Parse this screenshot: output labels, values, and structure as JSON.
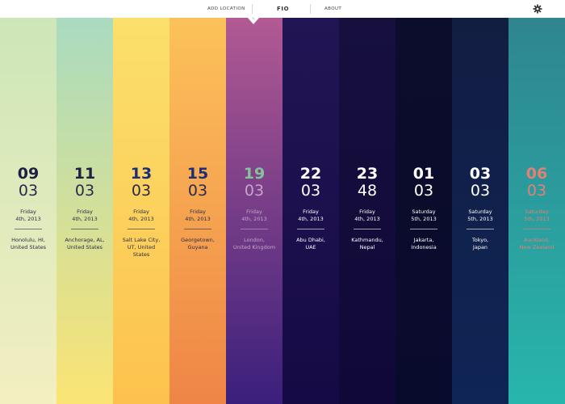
{
  "nav": {
    "add_location": "ADD LOCATION",
    "brand": "FIO",
    "about": "ABOUT",
    "settings_icon": "gear-icon"
  },
  "columns": [
    {
      "hour": "09",
      "minute": "03",
      "day": "Friday",
      "date": "4th, 2013",
      "place_line1": "Honolulu, HI,",
      "place_line2": "United States",
      "place_line3": "",
      "top": "#cde6b8",
      "bottom": "#f3efc1",
      "hour_color": "#1e1f44",
      "text_color": "#2a2b4a"
    },
    {
      "hour": "11",
      "minute": "03",
      "day": "Friday",
      "date": "4th, 2013",
      "place_line1": "Anchorage, AL,",
      "place_line2": "United States",
      "place_line3": "",
      "top": "#a9dbc0",
      "bottom": "#fbe474",
      "hour_color": "#1e1f44",
      "text_color": "#2a2b4a"
    },
    {
      "hour": "13",
      "minute": "03",
      "day": "Friday",
      "date": "4th, 2013",
      "place_line1": "Salt Lake City,",
      "place_line2": "UT, United",
      "place_line3": "States",
      "top": "#fbe06c",
      "bottom": "#fdc24d",
      "hour_color": "#1d2d7a",
      "text_color": "#2a2b4a"
    },
    {
      "hour": "15",
      "minute": "03",
      "day": "Friday",
      "date": "4th, 2013",
      "place_line1": "Georgetown,",
      "place_line2": "Guyana",
      "place_line3": "",
      "top": "#fcc25a",
      "bottom": "#ef8546",
      "hour_color": "#1d2d7a",
      "text_color": "#2a2b4a"
    },
    {
      "hour": "19",
      "minute": "03",
      "day": "Friday",
      "date": "4th, 2013",
      "place_line1": "London,",
      "place_line2": "United Kingdom",
      "place_line3": "",
      "top": "#b25a93",
      "bottom": "#3a1f7c",
      "hour_color": "#86c39a",
      "text_color": "#c4a6c9"
    },
    {
      "hour": "22",
      "minute": "03",
      "day": "Friday",
      "date": "4th, 2013",
      "place_line1": "Abu Dhabi,",
      "place_line2": "UAE",
      "place_line3": "",
      "top": "#221555",
      "bottom": "#160a45",
      "hour_color": "#ffffff",
      "text_color": "#ffffff"
    },
    {
      "hour": "23",
      "minute": "48",
      "day": "Friday",
      "date": "4th, 2013",
      "place_line1": "Kathmandu,",
      "place_line2": "Nepal",
      "place_line3": "",
      "top": "#17103f",
      "bottom": "#100837",
      "hour_color": "#ffffff",
      "text_color": "#ffffff"
    },
    {
      "hour": "01",
      "minute": "03",
      "day": "Saturday",
      "date": "5th, 2013",
      "place_line1": "Jakarta,",
      "place_line2": "Indonesia",
      "place_line3": "",
      "top": "#0c0c2c",
      "bottom": "#090b2d",
      "hour_color": "#ffffff",
      "text_color": "#ffffff"
    },
    {
      "hour": "03",
      "minute": "03",
      "day": "Saturday",
      "date": "5th, 2013",
      "place_line1": "Tokyo,",
      "place_line2": "Japan",
      "place_line3": "",
      "top": "#121d42",
      "bottom": "#0f2556",
      "hour_color": "#ffffff",
      "text_color": "#ffffff"
    },
    {
      "hour": "06",
      "minute": "03",
      "day": "Saturday",
      "date": "5th, 2013",
      "place_line1": "Auckland,",
      "place_line2": "New Zealand",
      "place_line3": "",
      "top": "#2f8590",
      "bottom": "#27b6ac",
      "hour_color": "#e08273",
      "text_color": "#e08273"
    }
  ]
}
